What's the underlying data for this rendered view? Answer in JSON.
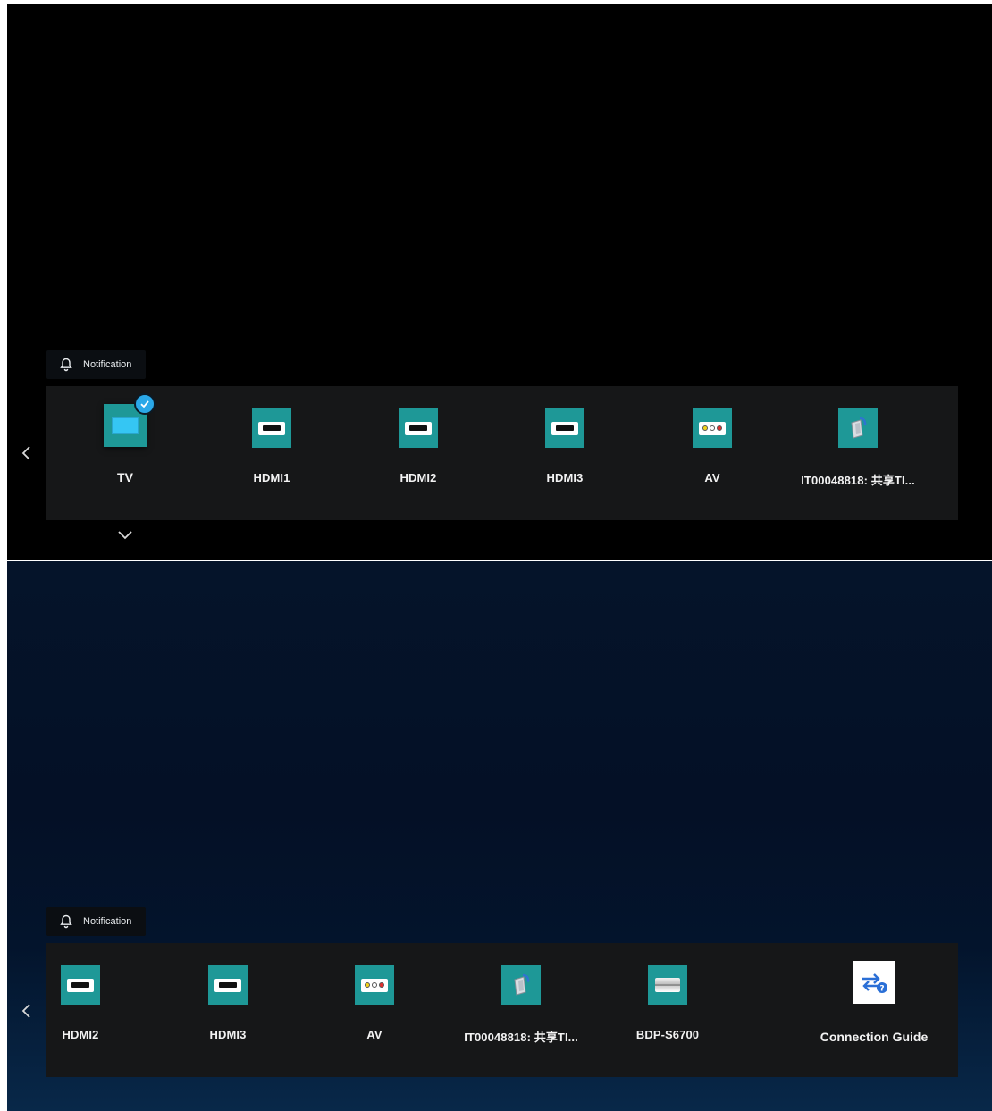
{
  "top_screen": {
    "notification_label": "Notification",
    "sources": [
      {
        "label": "TV",
        "icon": "tv-icon",
        "selected": true
      },
      {
        "label": "HDMI1",
        "icon": "hdmi-port-icon"
      },
      {
        "label": "HDMI2",
        "icon": "hdmi-port-icon"
      },
      {
        "label": "HDMI3",
        "icon": "hdmi-port-icon"
      },
      {
        "label": "AV",
        "icon": "av-port-icon"
      },
      {
        "label": "IT00048818: 共享TI...",
        "icon": "screen-share-icon"
      }
    ]
  },
  "bottom_screen": {
    "notification_label": "Notification",
    "sources": [
      {
        "label": "HDMI2",
        "icon": "hdmi-port-icon"
      },
      {
        "label": "HDMI3",
        "icon": "hdmi-port-icon"
      },
      {
        "label": "AV",
        "icon": "av-port-icon"
      },
      {
        "label": "IT00048818: 共享TI...",
        "icon": "screen-share-icon"
      },
      {
        "label": "BDP-S6700",
        "icon": "bluray-player-icon"
      }
    ],
    "connection_guide_label": "Connection Guide"
  },
  "colors": {
    "tile_teal": "#1e9897",
    "bar_background": "#161718",
    "check_blue": "#2aa8e8",
    "top_background": "#000000",
    "bottom_background": "#04122a"
  }
}
